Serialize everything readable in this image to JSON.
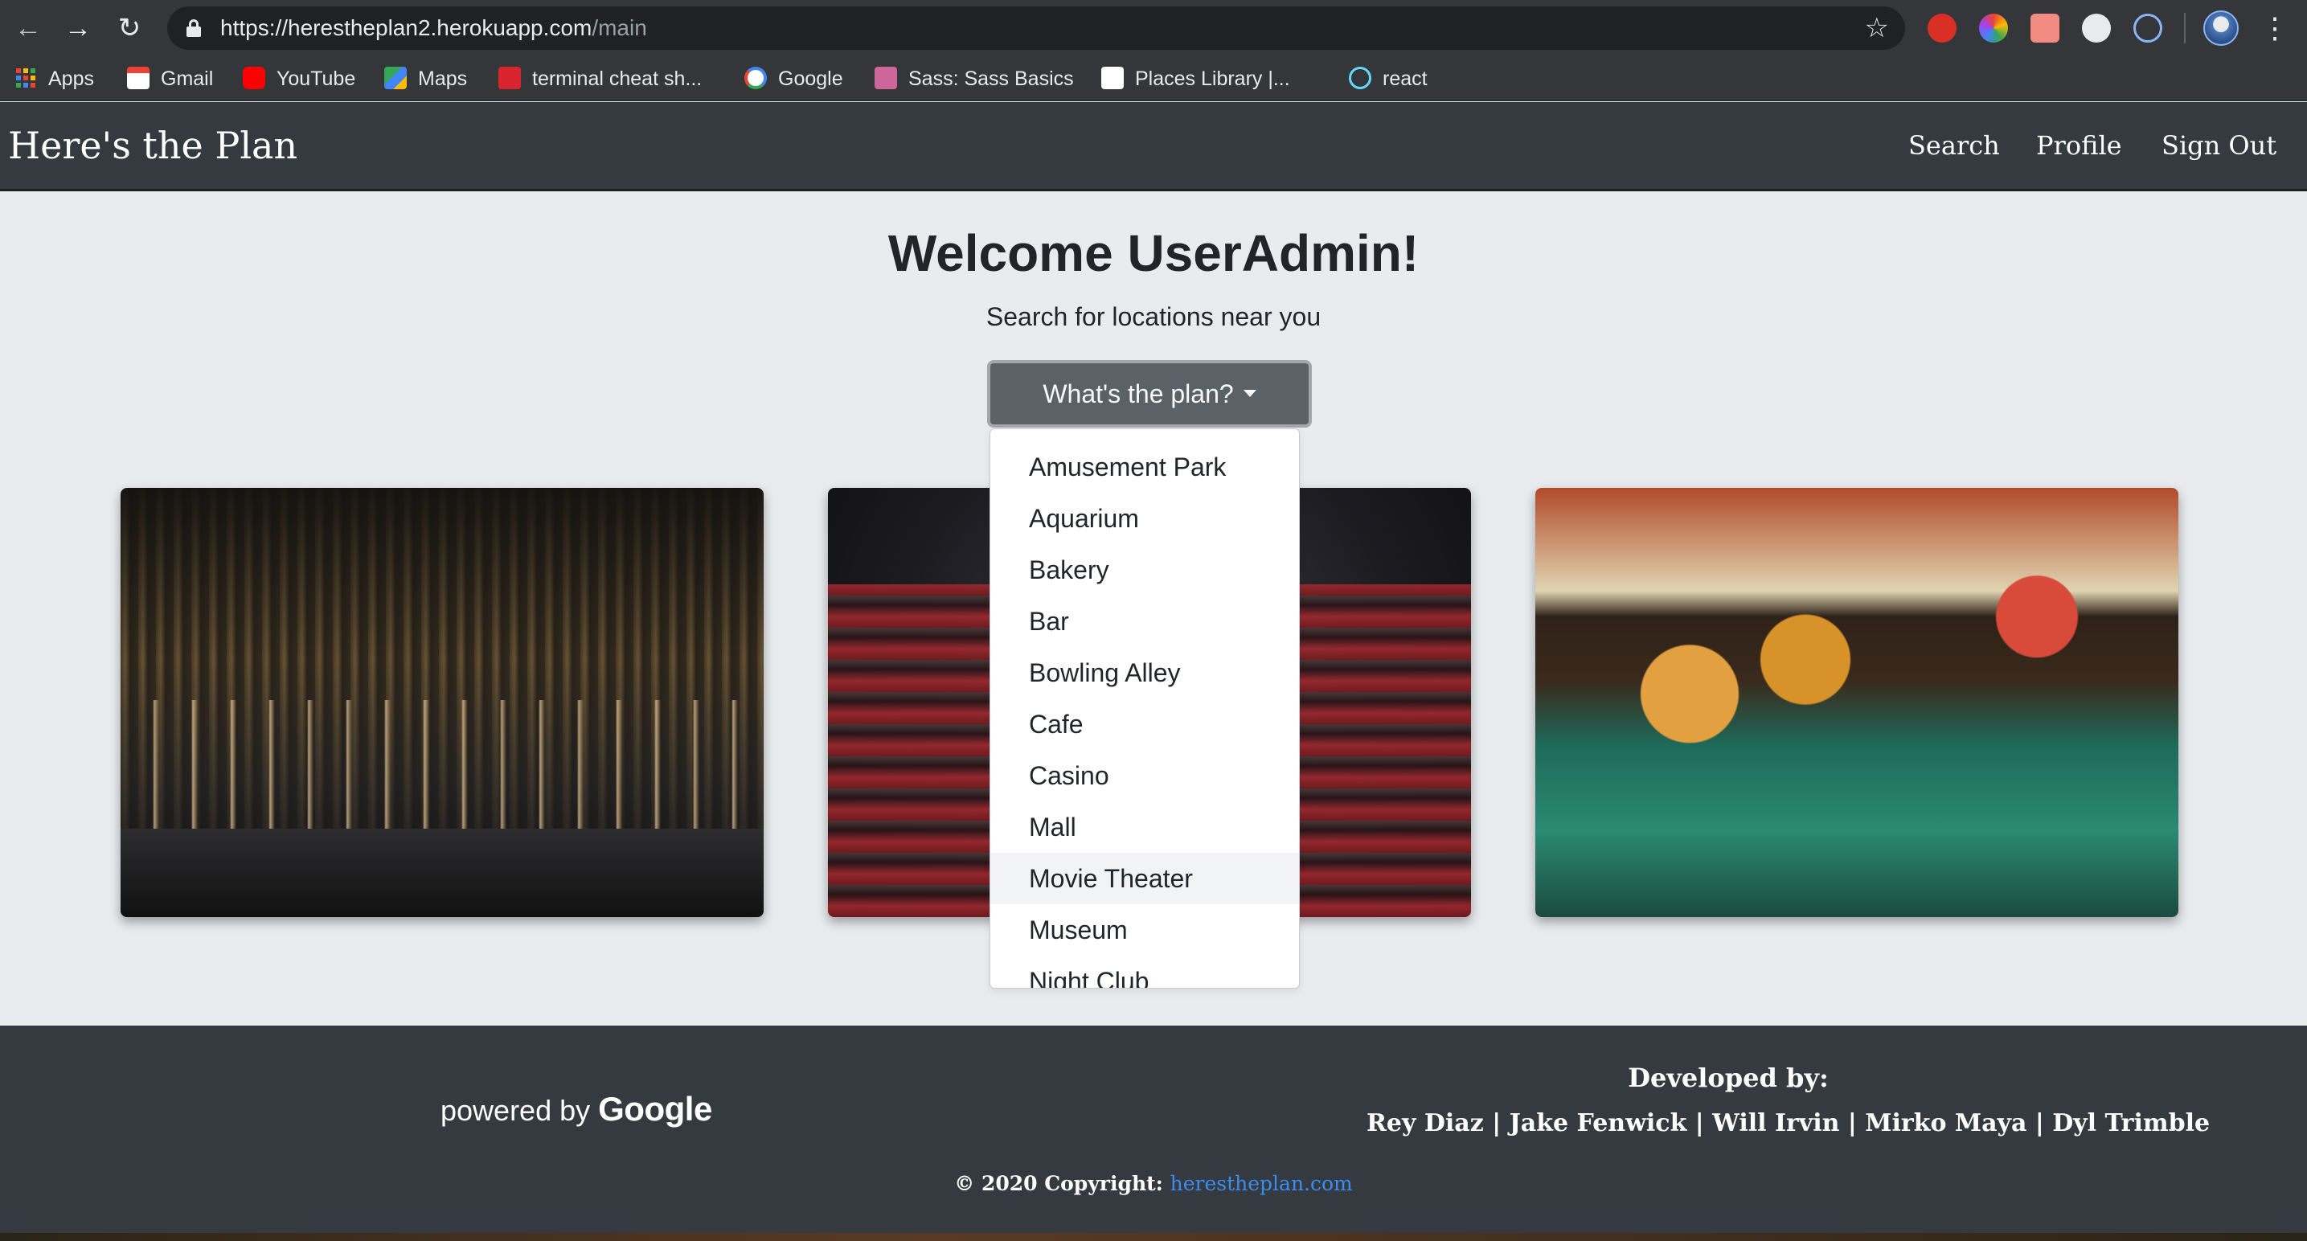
{
  "browser": {
    "url_host": "https://herestheplan2.herokuapp.com",
    "url_path": "/main",
    "icons": {
      "back": "arrow-left",
      "forward": "arrow-right",
      "reload": "reload",
      "bookmark": "star",
      "menu": "kebab"
    },
    "bookmarks": [
      {
        "label": "Apps",
        "icon": "apps-grid"
      },
      {
        "label": "Gmail",
        "icon": "gmail",
        "color": "#ea4335"
      },
      {
        "label": "YouTube",
        "icon": "youtube",
        "color": "#ff0000"
      },
      {
        "label": "Maps",
        "icon": "maps",
        "color": "#34a853"
      },
      {
        "label": "terminal cheat sh...",
        "icon": "terminal",
        "color": "#d9232d"
      },
      {
        "label": "Google",
        "icon": "google",
        "color": "#ffffff"
      },
      {
        "label": "Sass: Sass Basics",
        "icon": "sass",
        "color": "#cd6799"
      },
      {
        "label": "Places Library  |...",
        "icon": "places",
        "color": "#ffffff"
      },
      {
        "label": "react",
        "icon": "react",
        "color": "#61dafb"
      }
    ]
  },
  "navbar": {
    "brand": "Here's the Plan",
    "links": [
      "Search",
      "Profile",
      "Sign Out"
    ]
  },
  "main": {
    "welcome": "Welcome UserAdmin!",
    "subtitle": "Search for locations near you",
    "dropdown_label": "What's the plan?",
    "dropdown_items": [
      "Amusement Park",
      "Aquarium",
      "Bakery",
      "Bar",
      "Bowling Alley",
      "Cafe",
      "Casino",
      "Mall",
      "Movie Theater",
      "Museum",
      "Night Club"
    ],
    "hovered_item": "Movie Theater"
  },
  "footer": {
    "powered_prefix": "powered by",
    "powered_brand": "Google",
    "developed_by": "Developed by:",
    "developers": "Rey Diaz | Jake Fenwick | Will Irvin | Mirko Maya | Dyl Trimble",
    "copyright_prefix": "© 2020 Copyright:",
    "copyright_link": "herestheplan.com"
  },
  "colors": {
    "navbar": "#343a40",
    "page_bg": "#e9ecef",
    "button": "#5a6268",
    "link": "#3b8df0"
  }
}
